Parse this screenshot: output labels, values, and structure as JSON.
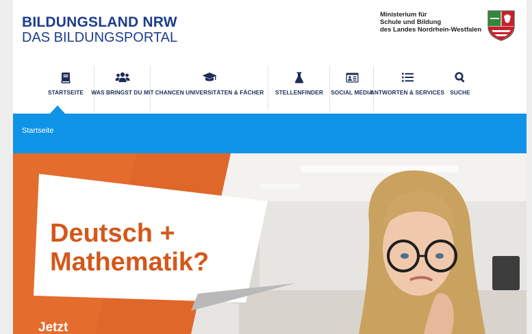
{
  "header": {
    "brand_line1": "BILDUNGSLAND NRW",
    "brand_line2": "DAS BILDUNGSPORTAL",
    "ministry_lines": [
      "Ministerium für",
      "Schule und Bildung",
      "des Landes Nordrhein-Westfalen"
    ],
    "crest_icon": "nrw-coat-of-arms-icon"
  },
  "nav": {
    "items": [
      {
        "label": "STARTSEITE",
        "icon": "book-icon",
        "active": true
      },
      {
        "label": "WAS BRINGST DU MIT",
        "icon": "users-icon"
      },
      {
        "label": "CHANCEN UNIVERSITÄTEN & FÄCHER",
        "icon": "graduation-cap-icon"
      },
      {
        "label": "STELLENFINDER",
        "icon": "flask-icon"
      },
      {
        "label": "SOCIAL MEDIA",
        "icon": "id-card-icon"
      },
      {
        "label": "ANTWORTEN & SERVICES",
        "icon": "list-icon"
      },
      {
        "label": "SUCHE",
        "icon": "search-icon"
      }
    ]
  },
  "breadcrumb": {
    "current": "Startseite"
  },
  "hero": {
    "title_line1": "Deutsch +",
    "title_line2": "Mathematik?",
    "cta_partial": "Jetzt"
  },
  "colors": {
    "brand_blue": "#1d3c8f",
    "nav_text": "#1d2c5a",
    "breadcrumb_bg": "#0f93e6",
    "hero_orange": "#e0672a",
    "hero_title": "#d3581b"
  }
}
